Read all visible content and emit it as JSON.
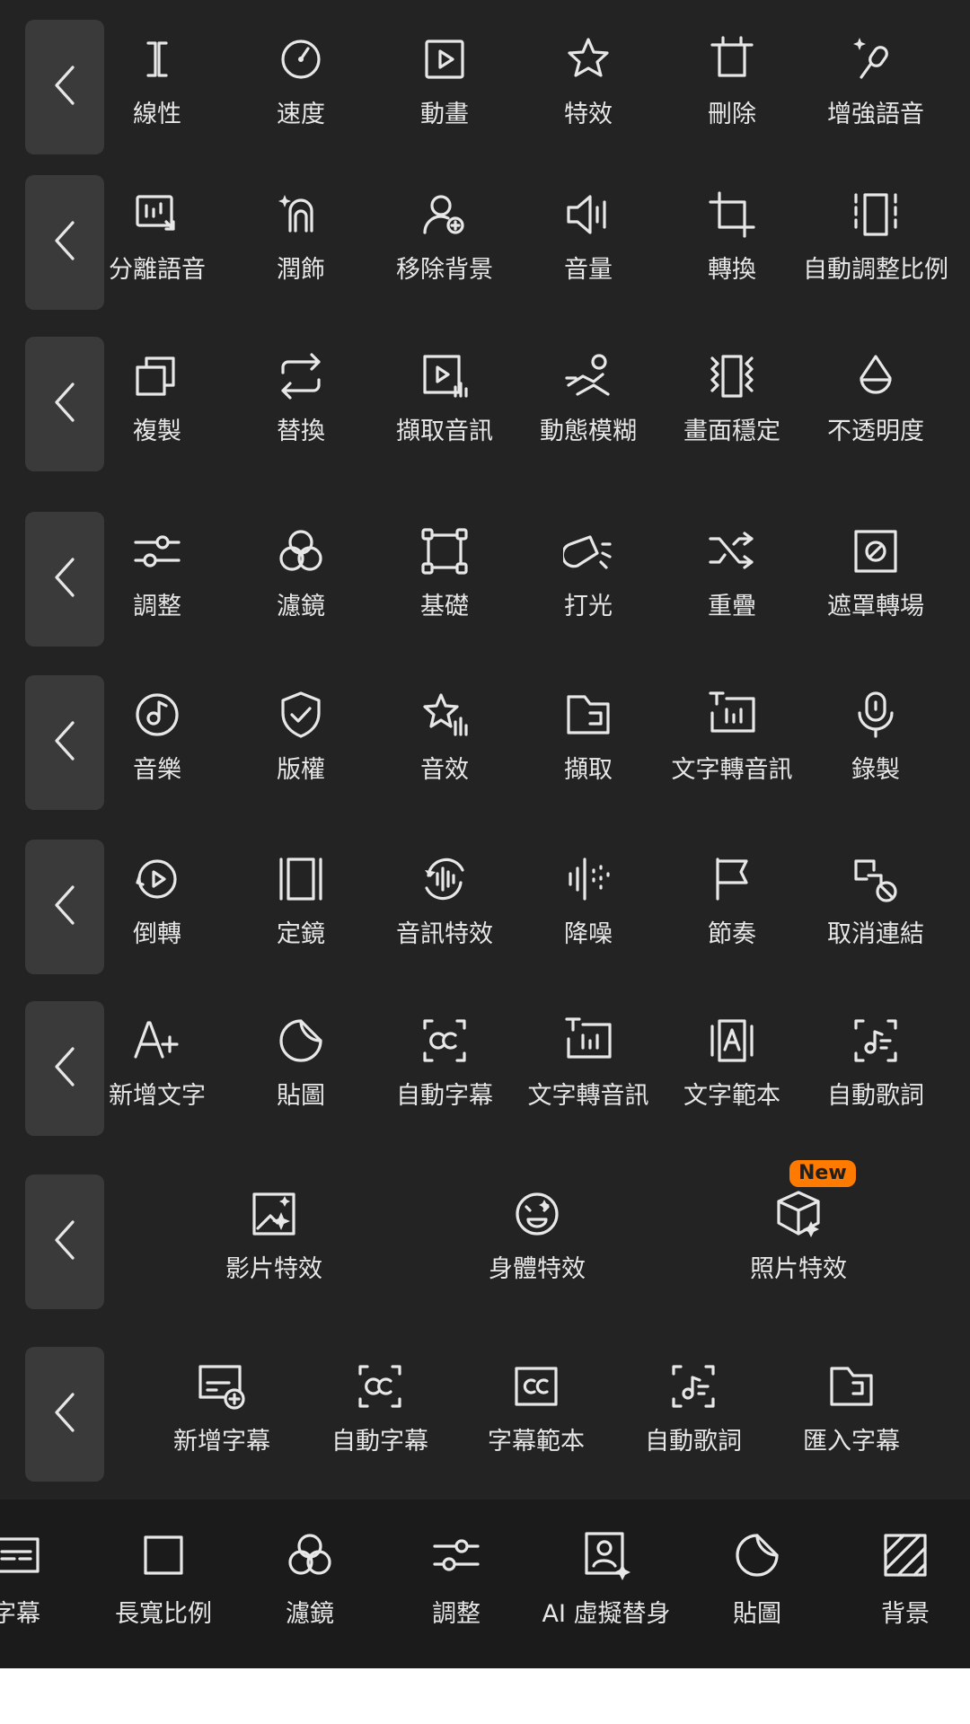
{
  "back_icon": "chevron-left-icon",
  "rows": [
    {
      "tools": [
        {
          "label": "線性",
          "icon": "linear-icon"
        },
        {
          "label": "速度",
          "icon": "speed-icon"
        },
        {
          "label": "動畫",
          "icon": "animation-icon"
        },
        {
          "label": "特效",
          "icon": "effect-star-icon"
        },
        {
          "label": "刪除",
          "icon": "delete-icon"
        },
        {
          "label": "增強語音",
          "icon": "enhance-voice-icon"
        }
      ]
    },
    {
      "tools": [
        {
          "label": "分離語音",
          "icon": "separate-voice-icon"
        },
        {
          "label": "潤飾",
          "icon": "retouch-icon"
        },
        {
          "label": "移除背景",
          "icon": "remove-background-icon"
        },
        {
          "label": "音量",
          "icon": "volume-icon"
        },
        {
          "label": "轉換",
          "icon": "crop-icon"
        },
        {
          "label": "自動調整比例",
          "icon": "auto-reframe-icon"
        }
      ]
    },
    {
      "tools": [
        {
          "label": "複製",
          "icon": "copy-icon"
        },
        {
          "label": "替換",
          "icon": "replace-icon"
        },
        {
          "label": "擷取音訊",
          "icon": "extract-audio-icon"
        },
        {
          "label": "動態模糊",
          "icon": "motion-blur-icon"
        },
        {
          "label": "畫面穩定",
          "icon": "stabilize-icon"
        },
        {
          "label": "不透明度",
          "icon": "opacity-icon"
        }
      ]
    },
    {
      "tools": [
        {
          "label": "調整",
          "icon": "adjust-sliders-icon"
        },
        {
          "label": "濾鏡",
          "icon": "filter-icon"
        },
        {
          "label": "基礎",
          "icon": "transform-box-icon"
        },
        {
          "label": "打光",
          "icon": "lighting-icon"
        },
        {
          "label": "重疊",
          "icon": "overlay-shuffle-icon"
        },
        {
          "label": "遮罩轉場",
          "icon": "mask-transition-icon"
        }
      ]
    },
    {
      "tools": [
        {
          "label": "音樂",
          "icon": "music-icon"
        },
        {
          "label": "版權",
          "icon": "copyright-shield-icon"
        },
        {
          "label": "音效",
          "icon": "sound-effect-icon"
        },
        {
          "label": "擷取",
          "icon": "extract-folder-icon"
        },
        {
          "label": "文字轉音訊",
          "icon": "text-to-speech-icon"
        },
        {
          "label": "錄製",
          "icon": "microphone-icon"
        }
      ]
    },
    {
      "tools": [
        {
          "label": "倒轉",
          "icon": "reverse-icon"
        },
        {
          "label": "定鏡",
          "icon": "freeze-frame-icon"
        },
        {
          "label": "音訊特效",
          "icon": "audio-effect-icon"
        },
        {
          "label": "降噪",
          "icon": "noise-reduction-icon"
        },
        {
          "label": "節奏",
          "icon": "beat-flag-icon"
        },
        {
          "label": "取消連結",
          "icon": "unlink-icon"
        }
      ]
    },
    {
      "tools": [
        {
          "label": "新增文字",
          "icon": "add-text-icon"
        },
        {
          "label": "貼圖",
          "icon": "sticker-icon"
        },
        {
          "label": "自動字幕",
          "icon": "auto-caption-icon"
        },
        {
          "label": "文字轉音訊",
          "icon": "text-to-speech-icon"
        },
        {
          "label": "文字範本",
          "icon": "text-template-icon"
        },
        {
          "label": "自動歌詞",
          "icon": "auto-lyrics-icon"
        }
      ]
    },
    {
      "tools": [
        {
          "label": "影片特效",
          "icon": "video-effect-icon"
        },
        {
          "label": "身體特效",
          "icon": "body-effect-icon"
        },
        {
          "label": "照片特效",
          "icon": "photo-effect-icon",
          "badge": "New"
        }
      ]
    },
    {
      "tools": [
        {
          "label": "新增字幕",
          "icon": "add-caption-icon"
        },
        {
          "label": "自動字幕",
          "icon": "auto-caption-icon"
        },
        {
          "label": "字幕範本",
          "icon": "caption-template-icon"
        },
        {
          "label": "自動歌詞",
          "icon": "auto-lyrics-icon"
        },
        {
          "label": "匯入字幕",
          "icon": "import-caption-icon"
        }
      ]
    }
  ],
  "bottom_bar": [
    {
      "label": "字幕",
      "icon": "caption-icon"
    },
    {
      "label": "長寬比例",
      "icon": "aspect-ratio-icon"
    },
    {
      "label": "濾鏡",
      "icon": "filter-icon"
    },
    {
      "label": "調整",
      "icon": "adjust-sliders-icon"
    },
    {
      "label": "AI 虛擬替身",
      "icon": "ai-avatar-icon"
    },
    {
      "label": "貼圖",
      "icon": "sticker-icon"
    },
    {
      "label": "背景",
      "icon": "background-icon"
    }
  ],
  "colors": {
    "panel": "#232323",
    "button": "#3a3a3a",
    "bottom_bar": "#1b1b1b",
    "text": "#e7e7e7",
    "badge": "#ff7a00"
  }
}
